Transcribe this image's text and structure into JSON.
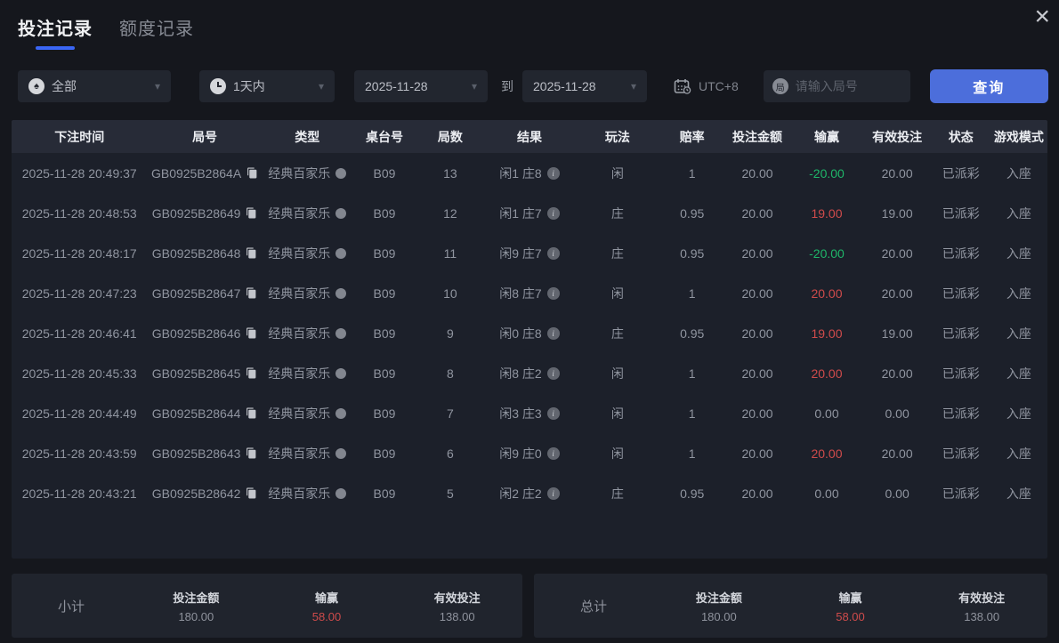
{
  "header": {
    "tabs": [
      {
        "label": "投注记录",
        "active": true
      },
      {
        "label": "额度记录",
        "active": false
      }
    ],
    "close_icon": "×"
  },
  "filters": {
    "game_type": {
      "value": "全部",
      "icon": "spade-icon",
      "icon_char": "♠",
      "chevron": "▾"
    },
    "time_range": {
      "value": "1天内",
      "icon": "clock-icon",
      "chevron": "▾"
    },
    "date_from": {
      "value": "2025-11-28",
      "chevron": "▾"
    },
    "to_label": "到",
    "date_to": {
      "value": "2025-11-28",
      "chevron": "▾"
    },
    "timezone": {
      "label": "UTC+8",
      "icon": "calendar-clock-icon"
    },
    "round_search": {
      "placeholder": "请输入局号",
      "icon": "round-badge-icon",
      "icon_char": "局"
    },
    "query_button": "查询"
  },
  "table": {
    "columns": [
      "下注时间",
      "局号",
      "类型",
      "桌台号",
      "局数",
      "结果",
      "玩法",
      "赔率",
      "投注金额",
      "输赢",
      "有效投注",
      "状态",
      "游戏模式"
    ],
    "rows": [
      {
        "time": "2025-11-28 20:49:37",
        "round_id": "GB0925B2864A",
        "type": "经典百家乐",
        "table_no": "B09",
        "round_no": "13",
        "result": "闲1 庄8",
        "play": "闲",
        "odds": "1",
        "bet_amount": "20.00",
        "win_loss": "-20.00",
        "win_loss_color": "green",
        "valid_bet": "20.00",
        "status": "已派彩",
        "game_mode": "入座"
      },
      {
        "time": "2025-11-28 20:48:53",
        "round_id": "GB0925B28649",
        "type": "经典百家乐",
        "table_no": "B09",
        "round_no": "12",
        "result": "闲1 庄7",
        "play": "庄",
        "odds": "0.95",
        "bet_amount": "20.00",
        "win_loss": "19.00",
        "win_loss_color": "red",
        "valid_bet": "19.00",
        "status": "已派彩",
        "game_mode": "入座"
      },
      {
        "time": "2025-11-28 20:48:17",
        "round_id": "GB0925B28648",
        "type": "经典百家乐",
        "table_no": "B09",
        "round_no": "11",
        "result": "闲9 庄7",
        "play": "庄",
        "odds": "0.95",
        "bet_amount": "20.00",
        "win_loss": "-20.00",
        "win_loss_color": "green",
        "valid_bet": "20.00",
        "status": "已派彩",
        "game_mode": "入座"
      },
      {
        "time": "2025-11-28 20:47:23",
        "round_id": "GB0925B28647",
        "type": "经典百家乐",
        "table_no": "B09",
        "round_no": "10",
        "result": "闲8 庄7",
        "play": "闲",
        "odds": "1",
        "bet_amount": "20.00",
        "win_loss": "20.00",
        "win_loss_color": "red",
        "valid_bet": "20.00",
        "status": "已派彩",
        "game_mode": "入座"
      },
      {
        "time": "2025-11-28 20:46:41",
        "round_id": "GB0925B28646",
        "type": "经典百家乐",
        "table_no": "B09",
        "round_no": "9",
        "result": "闲0 庄8",
        "play": "庄",
        "odds": "0.95",
        "bet_amount": "20.00",
        "win_loss": "19.00",
        "win_loss_color": "red",
        "valid_bet": "19.00",
        "status": "已派彩",
        "game_mode": "入座"
      },
      {
        "time": "2025-11-28 20:45:33",
        "round_id": "GB0925B28645",
        "type": "经典百家乐",
        "table_no": "B09",
        "round_no": "8",
        "result": "闲8 庄2",
        "play": "闲",
        "odds": "1",
        "bet_amount": "20.00",
        "win_loss": "20.00",
        "win_loss_color": "red",
        "valid_bet": "20.00",
        "status": "已派彩",
        "game_mode": "入座"
      },
      {
        "time": "2025-11-28 20:44:49",
        "round_id": "GB0925B28644",
        "type": "经典百家乐",
        "table_no": "B09",
        "round_no": "7",
        "result": "闲3 庄3",
        "play": "闲",
        "odds": "1",
        "bet_amount": "20.00",
        "win_loss": "0.00",
        "win_loss_color": "neutral",
        "valid_bet": "0.00",
        "status": "已派彩",
        "game_mode": "入座"
      },
      {
        "time": "2025-11-28 20:43:59",
        "round_id": "GB0925B28643",
        "type": "经典百家乐",
        "table_no": "B09",
        "round_no": "6",
        "result": "闲9 庄0",
        "play": "闲",
        "odds": "1",
        "bet_amount": "20.00",
        "win_loss": "20.00",
        "win_loss_color": "red",
        "valid_bet": "20.00",
        "status": "已派彩",
        "game_mode": "入座"
      },
      {
        "time": "2025-11-28 20:43:21",
        "round_id": "GB0925B28642",
        "type": "经典百家乐",
        "table_no": "B09",
        "round_no": "5",
        "result": "闲2 庄2",
        "play": "庄",
        "odds": "0.95",
        "bet_amount": "20.00",
        "win_loss": "0.00",
        "win_loss_color": "neutral",
        "valid_bet": "0.00",
        "status": "已派彩",
        "game_mode": "入座"
      }
    ]
  },
  "summary": {
    "subtotal": {
      "title": "小计",
      "bet_label": "投注金额",
      "bet": "180.00",
      "winloss_label": "输赢",
      "winloss": "58.00",
      "valid_label": "有效投注",
      "valid": "138.00"
    },
    "total": {
      "title": "总计",
      "bet_label": "投注金额",
      "bet": "180.00",
      "winloss_label": "输赢",
      "winloss": "58.00",
      "valid_label": "有效投注",
      "valid": "138.00"
    }
  },
  "colors": {
    "accent_blue": "#4c6edb",
    "tab_underline_blue": "#3a66f5",
    "win_red": "#cf4b4b",
    "loss_green": "#1fb569",
    "page_bg": "#15171d",
    "table_bg": "#1c202a",
    "header_row_bg": "#272b37"
  }
}
